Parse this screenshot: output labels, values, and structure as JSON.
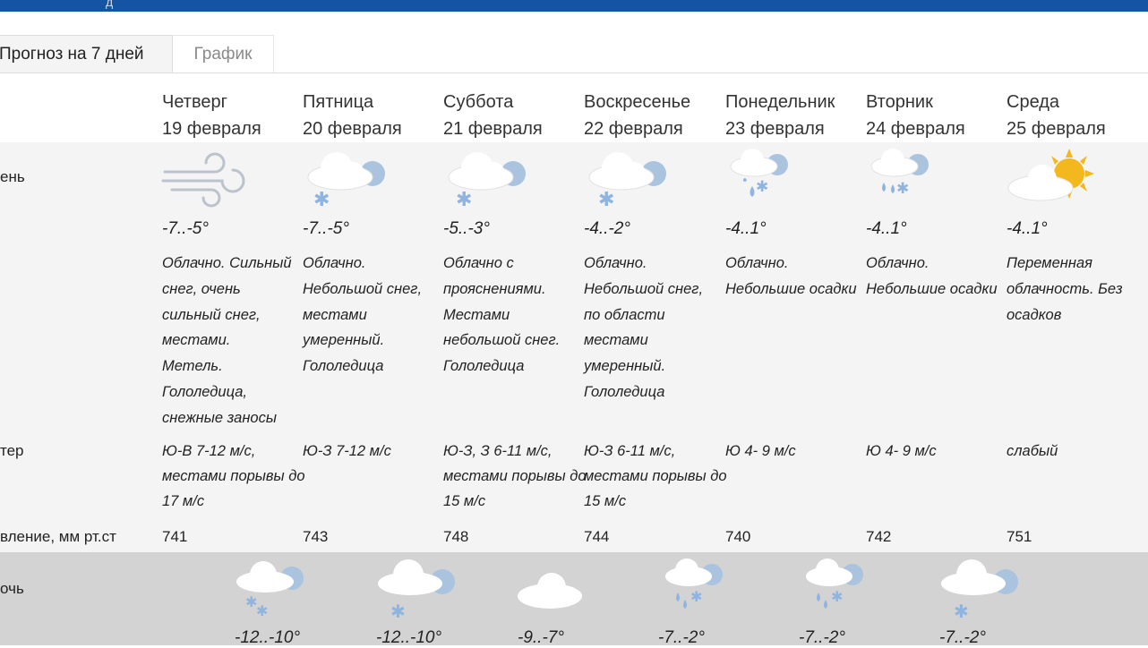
{
  "header": {
    "fragment": "д"
  },
  "tabs": [
    {
      "label": "Прогноз на 7 дней"
    },
    {
      "label": "График"
    }
  ],
  "labels": {
    "day": "ень",
    "wind": "тер",
    "pressure": "вление, мм рт.ст",
    "night": "очь"
  },
  "days": [
    {
      "weekday": "Четверг",
      "date": "19 февраля",
      "day_icon": "wind-icon",
      "day_temp": "-7..-5°",
      "desc": "Облачно. Сильный снег, очень сильный снег, местами. Метель. Гололедица, снежные заносы",
      "wind": "Ю-В 7-12 м/с, местами порывы до 17 м/с",
      "pressure": "741",
      "night_icon": "cloud-snow-icon",
      "night_temp": "-12..-10°"
    },
    {
      "weekday": "Пятница",
      "date": "20 февраля",
      "day_icon": "cloud-snow-icon",
      "day_temp": "-7..-5°",
      "desc": "Облачно. Небольшой снег, местами умеренный. Гололедица",
      "wind": "Ю-З 7-12 м/с",
      "pressure": "743",
      "night_icon": "cloud-snow-icon",
      "night_temp": "-12..-10°"
    },
    {
      "weekday": "Суббота",
      "date": "21 февраля",
      "day_icon": "cloud-snow-icon",
      "day_temp": "-5..-3°",
      "desc": "Облачно с прояснениями. Местами небольшой снег. Гололедица",
      "wind": "Ю-З, З 6-11 м/с, местами порывы до 15 м/с",
      "pressure": "748",
      "night_icon": "cloud-moon-icon",
      "night_temp": "-9..-7°"
    },
    {
      "weekday": "Воскресенье",
      "date": "22 февраля",
      "day_icon": "cloud-snow-icon",
      "day_temp": "-4..-2°",
      "desc": "Облачно. Небольшой снег, по области местами умеренный. Гололедица",
      "wind": "Ю-З 6-11 м/с, местами порывы до 15 м/с",
      "pressure": "744",
      "night_icon": "cloud-sleet-icon",
      "night_temp": "-7..-2°"
    },
    {
      "weekday": "Понедельник",
      "date": "23 февраля",
      "day_icon": "cloud-sleet-icon",
      "day_temp": "-4..1°",
      "desc": "Облачно. Небольшие осадки",
      "wind": "Ю 4- 9 м/с",
      "pressure": "740",
      "night_icon": "cloud-sleet-icon",
      "night_temp": "-7..-2°"
    },
    {
      "weekday": "Вторник",
      "date": "24 февраля",
      "day_icon": "cloud-sleet-icon",
      "day_temp": "-4..1°",
      "desc": "Облачно. Небольшие осадки",
      "wind": "Ю 4- 9 м/с",
      "pressure": "742",
      "night_icon": "cloud-snow-icon",
      "night_temp": "-7..-2°"
    },
    {
      "weekday": "Среда",
      "date": "25 февраля",
      "day_icon": "cloud-sun-icon",
      "day_temp": "-4..1°",
      "desc": "Переменная облачность. Без осадков",
      "wind": "слабый",
      "pressure": "751"
    }
  ],
  "colors": {
    "header": "#1553a4",
    "day_band": "#f4f4f4",
    "night_band": "#d3d3d3",
    "snow": "#8fb4e0",
    "sun": "#f3b81d",
    "moon": "#fbe39a"
  }
}
